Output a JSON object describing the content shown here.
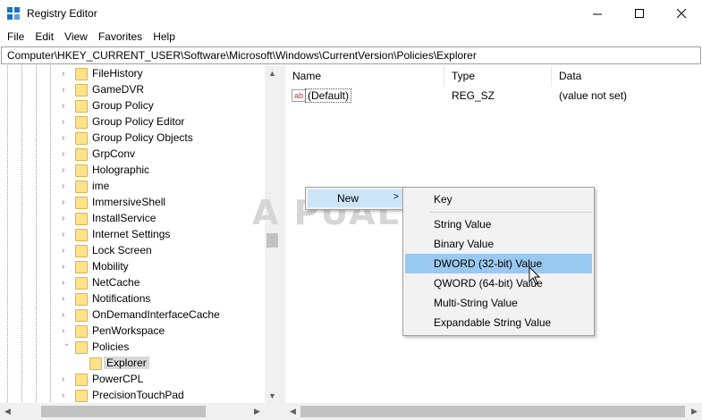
{
  "window": {
    "title": "Registry Editor",
    "minimize_glyph": "—",
    "maximize_glyph": "☐",
    "close_glyph": "✕"
  },
  "menu": [
    "File",
    "Edit",
    "View",
    "Favorites",
    "Help"
  ],
  "address": "Computer\\HKEY_CURRENT_USER\\Software\\Microsoft\\Windows\\CurrentVersion\\Policies\\Explorer",
  "tree": {
    "items": [
      {
        "label": "FileHistory",
        "state": "collapsed"
      },
      {
        "label": "GameDVR",
        "state": "collapsed"
      },
      {
        "label": "Group Policy",
        "state": "collapsed"
      },
      {
        "label": "Group Policy Editor",
        "state": "collapsed"
      },
      {
        "label": "Group Policy Objects",
        "state": "collapsed"
      },
      {
        "label": "GrpConv",
        "state": "collapsed"
      },
      {
        "label": "Holographic",
        "state": "collapsed"
      },
      {
        "label": "ime",
        "state": "collapsed"
      },
      {
        "label": "ImmersiveShell",
        "state": "collapsed"
      },
      {
        "label": "InstallService",
        "state": "collapsed"
      },
      {
        "label": "Internet Settings",
        "state": "collapsed"
      },
      {
        "label": "Lock Screen",
        "state": "collapsed"
      },
      {
        "label": "Mobility",
        "state": "collapsed"
      },
      {
        "label": "NetCache",
        "state": "collapsed"
      },
      {
        "label": "Notifications",
        "state": "collapsed"
      },
      {
        "label": "OnDemandInterfaceCache",
        "state": "collapsed"
      },
      {
        "label": "PenWorkspace",
        "state": "collapsed"
      },
      {
        "label": "Policies",
        "state": "expanded"
      },
      {
        "label": "Explorer",
        "state": "selected-child"
      },
      {
        "label": "PowerCPL",
        "state": "collapsed"
      },
      {
        "label": "PrecisionTouchPad",
        "state": "collapsed"
      }
    ]
  },
  "columns": {
    "name": "Name",
    "type": "Type",
    "data": "Data"
  },
  "values": [
    {
      "icon": "ab",
      "name": "(Default)",
      "type": "REG_SZ",
      "data": "(value not set)"
    }
  ],
  "watermark": "A PUALS",
  "context_menu": {
    "new_label": "New",
    "new_arrow": ">",
    "submenu": [
      "Key",
      "String Value",
      "Binary Value",
      "DWORD (32-bit) Value",
      "QWORD (64-bit) Value",
      "Multi-String Value",
      "Expandable String Value"
    ],
    "highlighted": "DWORD (32-bit) Value"
  },
  "colors": {
    "menu_highlight": "#99c8f0",
    "new_item_highlight": "#cce4f7",
    "folder": "#ffe38a"
  }
}
